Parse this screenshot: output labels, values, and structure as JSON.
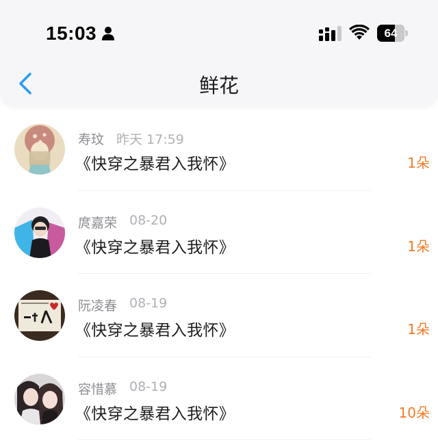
{
  "status_bar": {
    "time": "15:03",
    "battery_level": "64",
    "battery_fraction": 0.64,
    "icons": [
      "person-icon",
      "signal-icon",
      "wifi-icon",
      "battery-icon"
    ]
  },
  "nav": {
    "back_icon": "chevron-left-icon",
    "title": "鲜花",
    "accent_color": "#2a9df4"
  },
  "colors": {
    "count": "#f47a22",
    "name": "#8e8e93",
    "date": "#b0b0b5"
  },
  "gifts": [
    {
      "name": "寿玟",
      "date": "昨天 17:59",
      "book": "《快穿之暴君入我怀》",
      "count": "1朵"
    },
    {
      "name": "庹嘉荣",
      "date": "08-20",
      "book": "《快穿之暴君入我怀》",
      "count": "1朵"
    },
    {
      "name": "阮凌春",
      "date": "08-19",
      "book": "《快穿之暴君入我怀》",
      "count": "1朵"
    },
    {
      "name": "容惜慕",
      "date": "08-19",
      "book": "《快穿之暴君入我怀》",
      "count": "10朵"
    }
  ]
}
